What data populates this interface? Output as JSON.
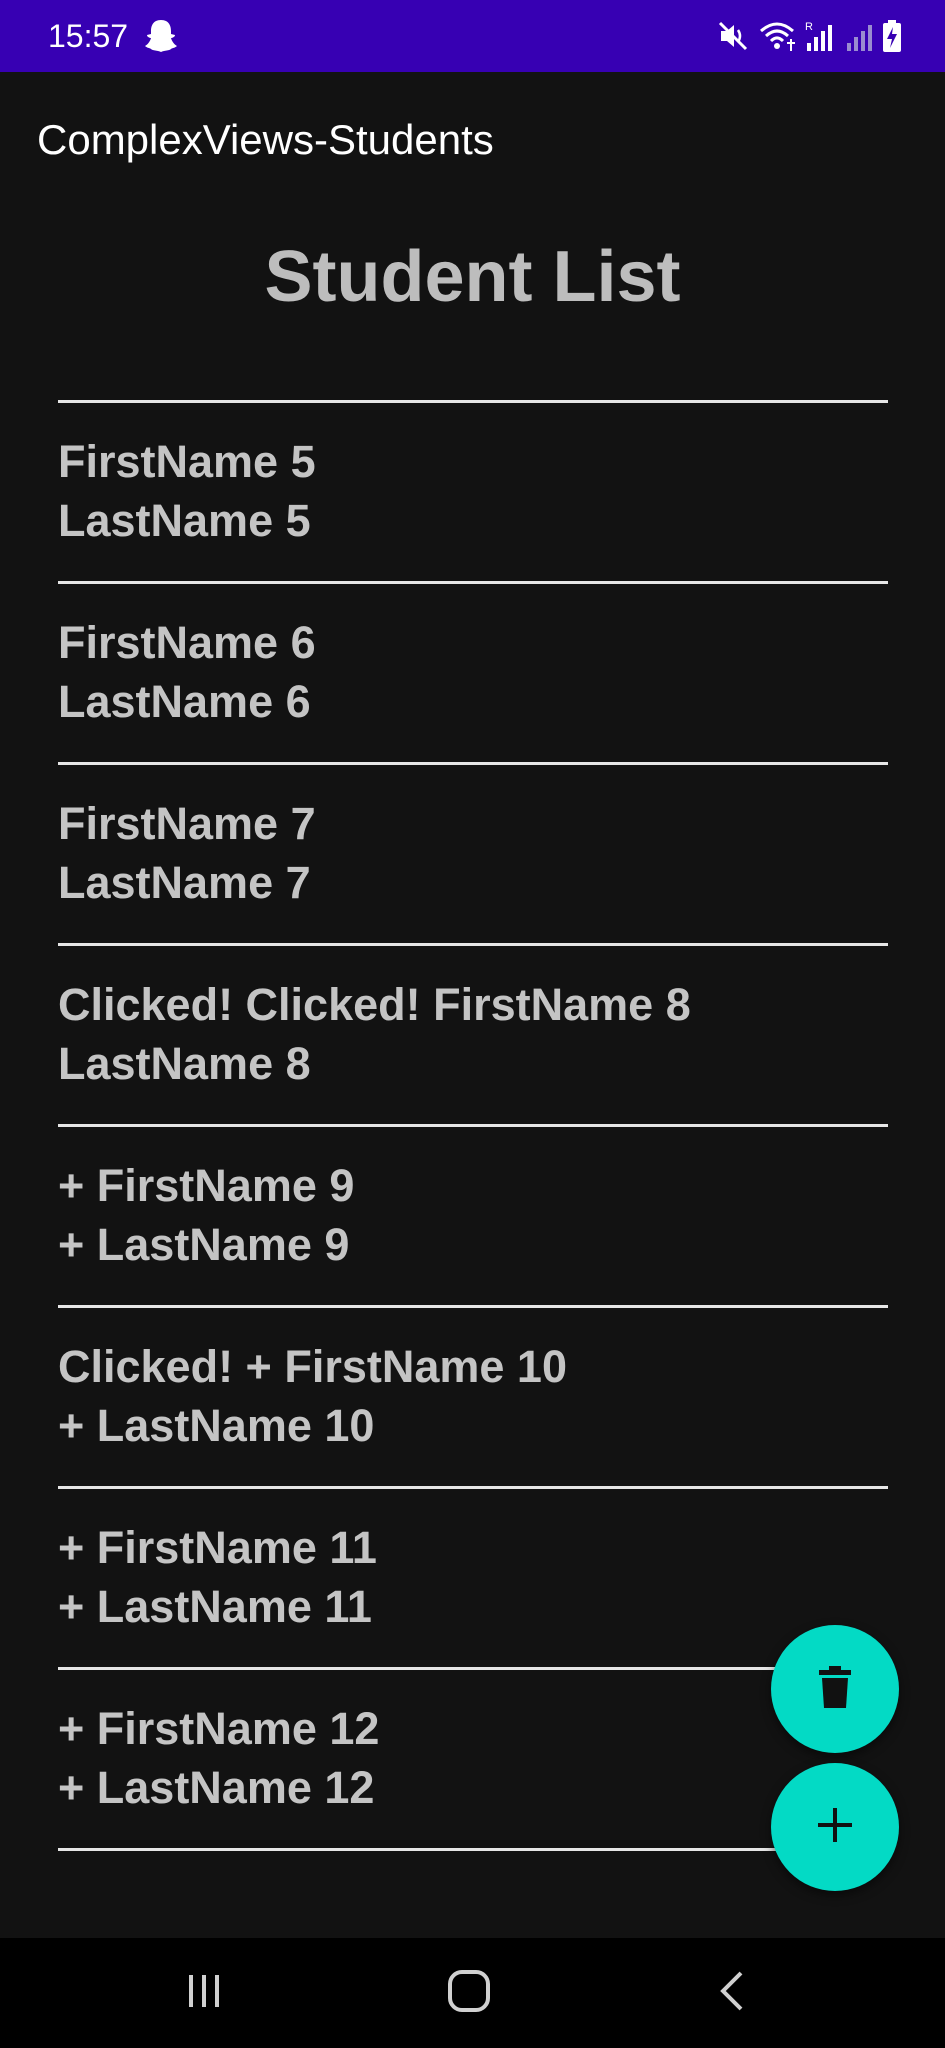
{
  "status_bar": {
    "time": "15:57",
    "icons": [
      "snapchat-icon",
      "mute-icon",
      "wifi-icon",
      "signal-icon",
      "signal-icon",
      "battery-charging-icon"
    ],
    "signal_label": "R"
  },
  "app": {
    "title": "ComplexViews-Students"
  },
  "page": {
    "title": "Student List"
  },
  "students": [
    {
      "first": "FirstName 5",
      "last": "LastName 5"
    },
    {
      "first": "FirstName 6",
      "last": "LastName 6"
    },
    {
      "first": "FirstName 7",
      "last": "LastName 7"
    },
    {
      "first": "Clicked! Clicked! FirstName 8",
      "last": "LastName 8"
    },
    {
      "first": "+ FirstName 9",
      "last": "+ LastName 9"
    },
    {
      "first": "Clicked! + FirstName 10",
      "last": "+ LastName 10"
    },
    {
      "first": "+ FirstName 11",
      "last": "+ LastName 11"
    },
    {
      "first": "+ FirstName 12",
      "last": "+ LastName 12"
    }
  ],
  "fabs": {
    "delete_icon": "trash-icon",
    "add_icon": "plus-icon"
  },
  "nav_bar": {
    "icons": [
      "recents-icon",
      "home-icon",
      "back-icon"
    ]
  },
  "colors": {
    "status_bar": "#3700B3",
    "background": "#121212",
    "fab": "#03DAC5",
    "text": "#c4c4c4"
  }
}
